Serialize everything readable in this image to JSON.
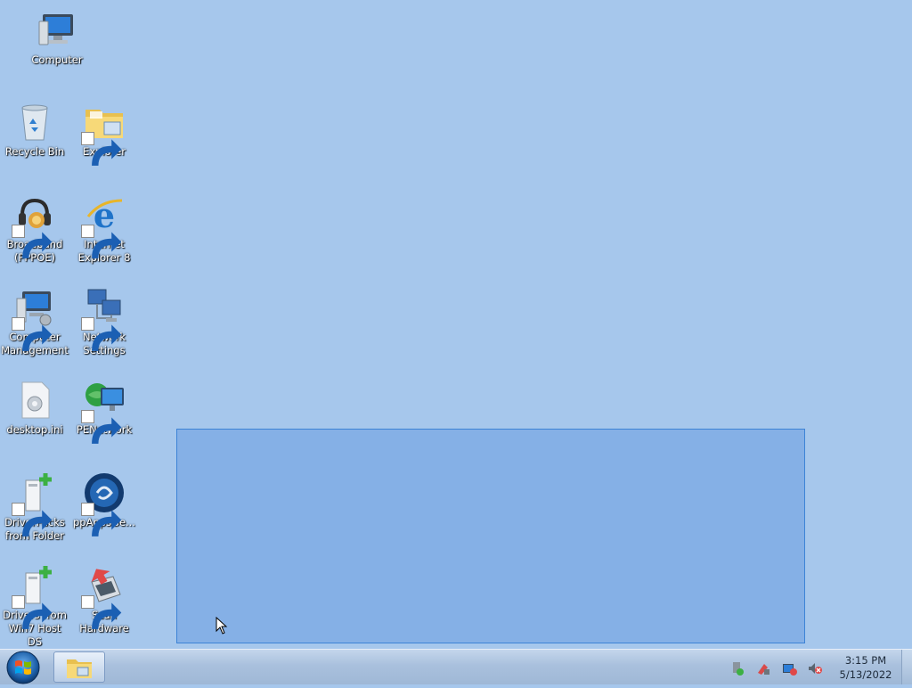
{
  "desktop": {
    "icons": [
      {
        "label": "Computer",
        "icon": "computer-icon"
      },
      {
        "label": "Recycle Bin",
        "icon": "recycle-bin-icon"
      },
      {
        "label": "Explorer",
        "icon": "folder-icon"
      },
      {
        "label": "Broadband\n(PPPOE)",
        "icon": "broadband-icon"
      },
      {
        "label": "Internet\nExplorer 8",
        "icon": "internet-explorer-icon"
      },
      {
        "label": "Computer\nManagement",
        "icon": "computer-management-icon"
      },
      {
        "label": "Network\nSettings",
        "icon": "network-settings-icon"
      },
      {
        "label": "desktop.ini",
        "icon": "settings-file-icon"
      },
      {
        "label": "PENetwork",
        "icon": "globe-network-icon"
      },
      {
        "label": "DriverPacks\nfrom Folder",
        "icon": "driverpack-icon"
      },
      {
        "label": "ppAppsGe...",
        "icon": "ppapps-icon"
      },
      {
        "label": "Drivers from\nWin7 Host DS",
        "icon": "driverpack-icon"
      },
      {
        "label": "Scan\nHardware",
        "icon": "scan-hardware-icon"
      }
    ]
  },
  "taskbar": {
    "start": {
      "icon": "windows-logo-icon"
    },
    "items": [
      {
        "icon": "folder-icon",
        "title": "Explorer"
      }
    ],
    "tray": [
      "safely-remove-icon",
      "network-icon",
      "action-center-icon",
      "volume-muted-icon"
    ],
    "clock": {
      "time": "3:15 PM",
      "date": "5/13/2022"
    }
  }
}
